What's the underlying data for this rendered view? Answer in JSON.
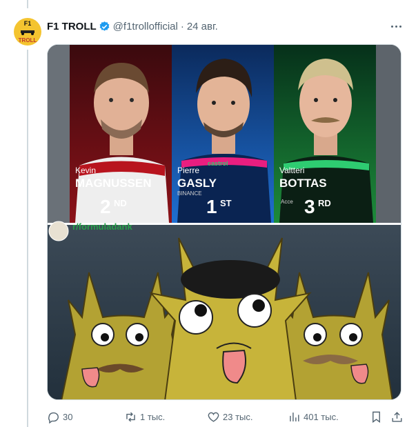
{
  "tweet": {
    "author_name": "F1 TROLL",
    "handle": "@f1trollofficial",
    "separator": "·",
    "date": "24 авг.",
    "avatar_text": {
      "line1": "F1",
      "line2": "TROLL"
    }
  },
  "podium": {
    "drivers": [
      {
        "first": "Kevin",
        "last": "MAGNUSSEN",
        "place_num": "2",
        "place_suffix": "ND",
        "team_color": "#b8141e"
      },
      {
        "first": "Pierre",
        "last": "GASLY",
        "place_num": "1",
        "place_suffix": "ST",
        "team_color": "#1f6fd1",
        "sponsor": "castrol",
        "sponsor2": "BINANCE"
      },
      {
        "first": "Valtteri",
        "last": "BOTTAS",
        "place_num": "3",
        "place_suffix": "RD",
        "team_color": "#1d8b3a",
        "sponsor2": "Acce"
      }
    ]
  },
  "meme": {
    "source_tag": "r/formuladank"
  },
  "actions": {
    "replies": "30",
    "reposts": "1 тыс.",
    "likes": "23 тыс.",
    "views": "401 тыс."
  },
  "icons": [
    "verified-icon",
    "more-icon",
    "reply-icon",
    "repost-icon",
    "like-icon",
    "views-icon",
    "bookmark-icon",
    "share-icon"
  ]
}
